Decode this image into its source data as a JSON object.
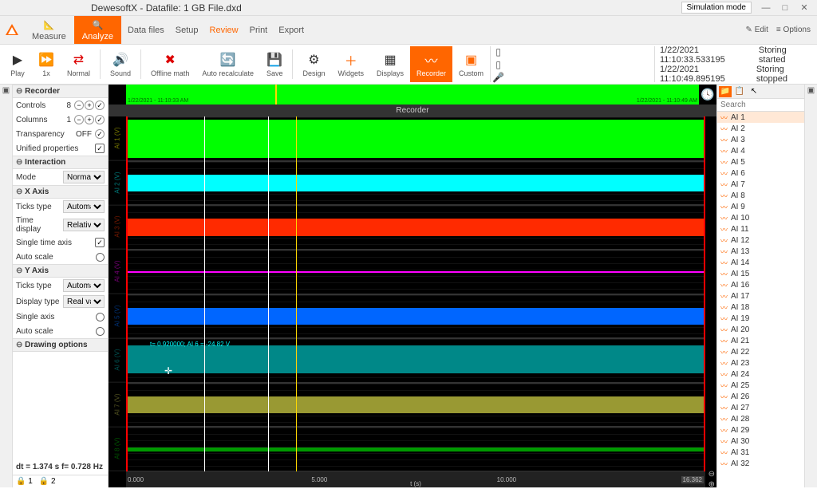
{
  "title": "DewesoftX - Datafile: 1 GB File.dxd",
  "simmode": "Simulation mode",
  "winbtns": {
    "min": "—",
    "max": "□",
    "close": "✕"
  },
  "menu": {
    "measure": "Measure",
    "analyze": "Analyze",
    "items": [
      "Data files",
      "Setup",
      "Review",
      "Print",
      "Export"
    ],
    "active_sub": "Review",
    "edit": "✎ Edit",
    "options": "≡ Options"
  },
  "toolbar": {
    "play": "Play",
    "x1": "1x",
    "normal": "Normal",
    "sound": "Sound",
    "offlinemath": "Offline math",
    "autorecalc": "Auto recalculate",
    "save": "Save",
    "design": "Design",
    "widgets": "Widgets",
    "displays": "Displays",
    "recorder": "Recorder",
    "custom": "Custom"
  },
  "events": [
    {
      "ts": "1/22/2021 11:10:33.533195",
      "msg": "Storing started"
    },
    {
      "ts": "1/22/2021 11:10:49.895195",
      "msg": "Storing stopped"
    }
  ],
  "left": {
    "sec_recorder": "Recorder",
    "controls": {
      "label": "Controls",
      "value": "8"
    },
    "columns": {
      "label": "Columns",
      "value": "1"
    },
    "transparency": {
      "label": "Transparency",
      "value": "OFF"
    },
    "unified": {
      "label": "Unified properties"
    },
    "sec_interaction": "Interaction",
    "mode": {
      "label": "Mode",
      "value": "Normal"
    },
    "sec_xaxis": "X Axis",
    "tickstype": {
      "label": "Ticks type",
      "value": "Automatic"
    },
    "timedisplay": {
      "label": "Time display",
      "value": "Relative"
    },
    "singletime": {
      "label": "Single time axis"
    },
    "autoscalex": {
      "label": "Auto scale"
    },
    "sec_yaxis": "Y Axis",
    "tickstypey": {
      "label": "Ticks type",
      "value": "Automatic"
    },
    "displaytype": {
      "label": "Display type",
      "value": "Real value"
    },
    "singleaxis": {
      "label": "Single axis"
    },
    "autoscaley": {
      "label": "Auto scale"
    },
    "sec_drawing": "Drawing options",
    "status": "dt = 1.374 s  f= 0.728 Hz",
    "lock1": "🔒 1",
    "lock2": "🔒 2"
  },
  "overview": {
    "ts_left": "1/22/2021 - 11:10:33 AM",
    "ts_right": "1/22/2021 - 11:10:49 AM"
  },
  "recorder_title": "Recorder",
  "tooltip": "t= 0.920000; AI 6 = -24.82 V",
  "xaxis": {
    "t0": "0.000",
    "t1": "5.000",
    "t2": "10.000",
    "t3": "16.362",
    "unit": "t (s)"
  },
  "tracks": [
    {
      "label": "AI 1 (V)",
      "color": "#00ff00",
      "lblcolor": "#7a7a00",
      "top": "5%",
      "bottom": "5%"
    },
    {
      "label": "AI 2 (V)",
      "color": "#00ffff",
      "lblcolor": "#007a7a"
    },
    {
      "label": "AI 3 (V)",
      "color": "#ff2a00",
      "lblcolor": "#7a1a00"
    },
    {
      "label": "AI 4 (V)",
      "color": "#ff00ff",
      "lblcolor": "#7a007a",
      "top": "48%",
      "bottom": "48%"
    },
    {
      "label": "AI 5 (V)",
      "color": "#0066ff",
      "lblcolor": "#00337a"
    },
    {
      "label": "AI 6 (V)",
      "color": "#008888",
      "lblcolor": "#005555",
      "top": "15%",
      "bottom": "20%"
    },
    {
      "label": "AI 7 (V)",
      "color": "#999933",
      "lblcolor": "#555522"
    },
    {
      "label": "AI 8 (V)",
      "color": "#009900",
      "lblcolor": "#005500",
      "top": "45%",
      "bottom": "45%"
    }
  ],
  "search_placeholder": "Search",
  "channels": [
    "AI 1",
    "AI 2",
    "AI 3",
    "AI 4",
    "AI 5",
    "AI 6",
    "AI 7",
    "AI 8",
    "AI 9",
    "AI 10",
    "AI 11",
    "AI 12",
    "AI 13",
    "AI 14",
    "AI 15",
    "AI 16",
    "AI 17",
    "AI 18",
    "AI 19",
    "AI 20",
    "AI 21",
    "AI 22",
    "AI 23",
    "AI 24",
    "AI 25",
    "AI 26",
    "AI 27",
    "AI 28",
    "AI 29",
    "AI 30",
    "AI 31",
    "AI 32"
  ]
}
